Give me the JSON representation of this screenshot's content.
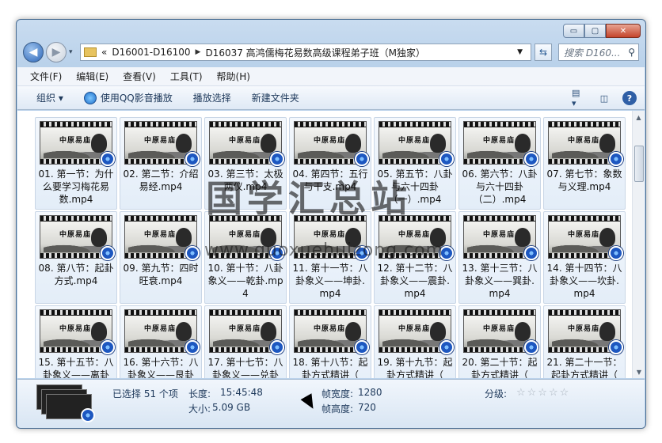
{
  "window": {
    "caption": {
      "min": "▭",
      "max": "▢",
      "close": "✕"
    }
  },
  "nav": {
    "back_icon": "back-arrow-icon",
    "forward_icon": "forward-arrow-icon",
    "history_icon": "▾"
  },
  "address": {
    "overflow": "«",
    "crumbs": [
      "D16001-D16100",
      "D16037 高鸿儒梅花易数高级课程弟子班（M独家）"
    ]
  },
  "search": {
    "placeholder": "搜索 D160..."
  },
  "menu": [
    "文件(F)",
    "编辑(E)",
    "查看(V)",
    "工具(T)",
    "帮助(H)"
  ],
  "toolbar": {
    "organize": "组织 ▾",
    "play_qq": "使用QQ影音播放",
    "play_selection": "播放选择",
    "new_folder": "新建文件夹",
    "help": "?"
  },
  "thumbnail_title": "中原易庙",
  "files": [
    "01. 第一节：为什么要学习梅花易数.mp4",
    "02. 第二节：介绍易经.mp4",
    "03. 第三节：太极两仪.mp4",
    "04. 第四节：五行与干支.mp4",
    "05. 第五节：八卦与六十四卦（一）.mp4",
    "06. 第六节：八卦与六十四卦（二）.mp4",
    "07. 第七节：象数与义理.mp4",
    "08. 第八节：起卦方式.mp4",
    "09. 第九节：四时旺衰.mp4",
    "10. 第十节：八卦象义——乾卦.mp4",
    "11. 第十一节：八卦象义——坤卦.mp4",
    "12. 第十二节：八卦象义——震卦.mp4",
    "13. 第十三节：八卦象义——巽卦.mp4",
    "14. 第十四节：八卦象义——坎卦.mp4",
    "15. 第十五节：八卦象义——离卦",
    "16. 第十六节：八卦象义——艮卦",
    "17. 第十七节：八卦象义——兑卦",
    "18. 第十八节：起卦方式精讲（",
    "19. 第十九节：起卦方式精讲（",
    "20. 第二十节：起卦方式精讲（",
    "21. 第二十一节：起卦方式精讲（"
  ],
  "details": {
    "selected": "已选择 51 个项",
    "length_label": "长度:",
    "length": "15:45:48",
    "size_label": "大小:",
    "size": "5.09 GB",
    "fw_label": "帧宽度:",
    "frame_width": "1280",
    "fh_label": "帧高度:",
    "frame_height": "720",
    "rating_label": "分级:",
    "stars": "☆☆☆☆☆"
  },
  "watermark": {
    "title": "国学汇总站",
    "url": "www.guoxuehuizong.com"
  }
}
